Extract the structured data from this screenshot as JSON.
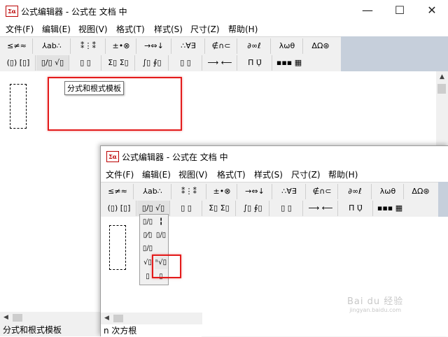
{
  "window": {
    "title": "公式编辑器 - 公式在 文档 中",
    "minimize": "—",
    "maximize": "☐",
    "close": "✕"
  },
  "menu": [
    "文件(F)",
    "编辑(E)",
    "视图(V)",
    "格式(T)",
    "样式(S)",
    "尺寸(Z)",
    "帮助(H)"
  ],
  "toolbar": {
    "row1": [
      "≤≠≈",
      "⅄ab∴",
      "⁑⋮⁑",
      "±•⊗",
      "→⇔↓",
      "∴∀∃",
      "∉∩⊂",
      "∂∞ℓ",
      "λωθ",
      "ΔΩ⊛"
    ],
    "row2": [
      "(▯) [▯]",
      "▯/▯ √▯",
      "▯ ▯",
      "Σ▯ Σ▯",
      "∫▯ ∮▯",
      "▯ ▯",
      "⟶ ⟵",
      "Π̈ Ụ̈",
      "▪▪▪ ▦"
    ]
  },
  "tooltip": "分式和根式模板",
  "status_bar_1": "分式和根式模板",
  "status_bar_2": "n 次方根",
  "dropdown_items": [
    "▯/▯",
    "╏",
    "▯⁄▯",
    "▯/▯",
    "▯/▯",
    "",
    "√▯",
    "ⁿ√▯",
    "▯",
    "▯"
  ],
  "watermark": {
    "brand": "Bai du 经验",
    "sub": "jingyan.baidu.com"
  },
  "colors": {
    "highlight": "#e31b1b",
    "toolbar_bg": "#f0f0f0",
    "gray_area": "#c6cfdb"
  }
}
